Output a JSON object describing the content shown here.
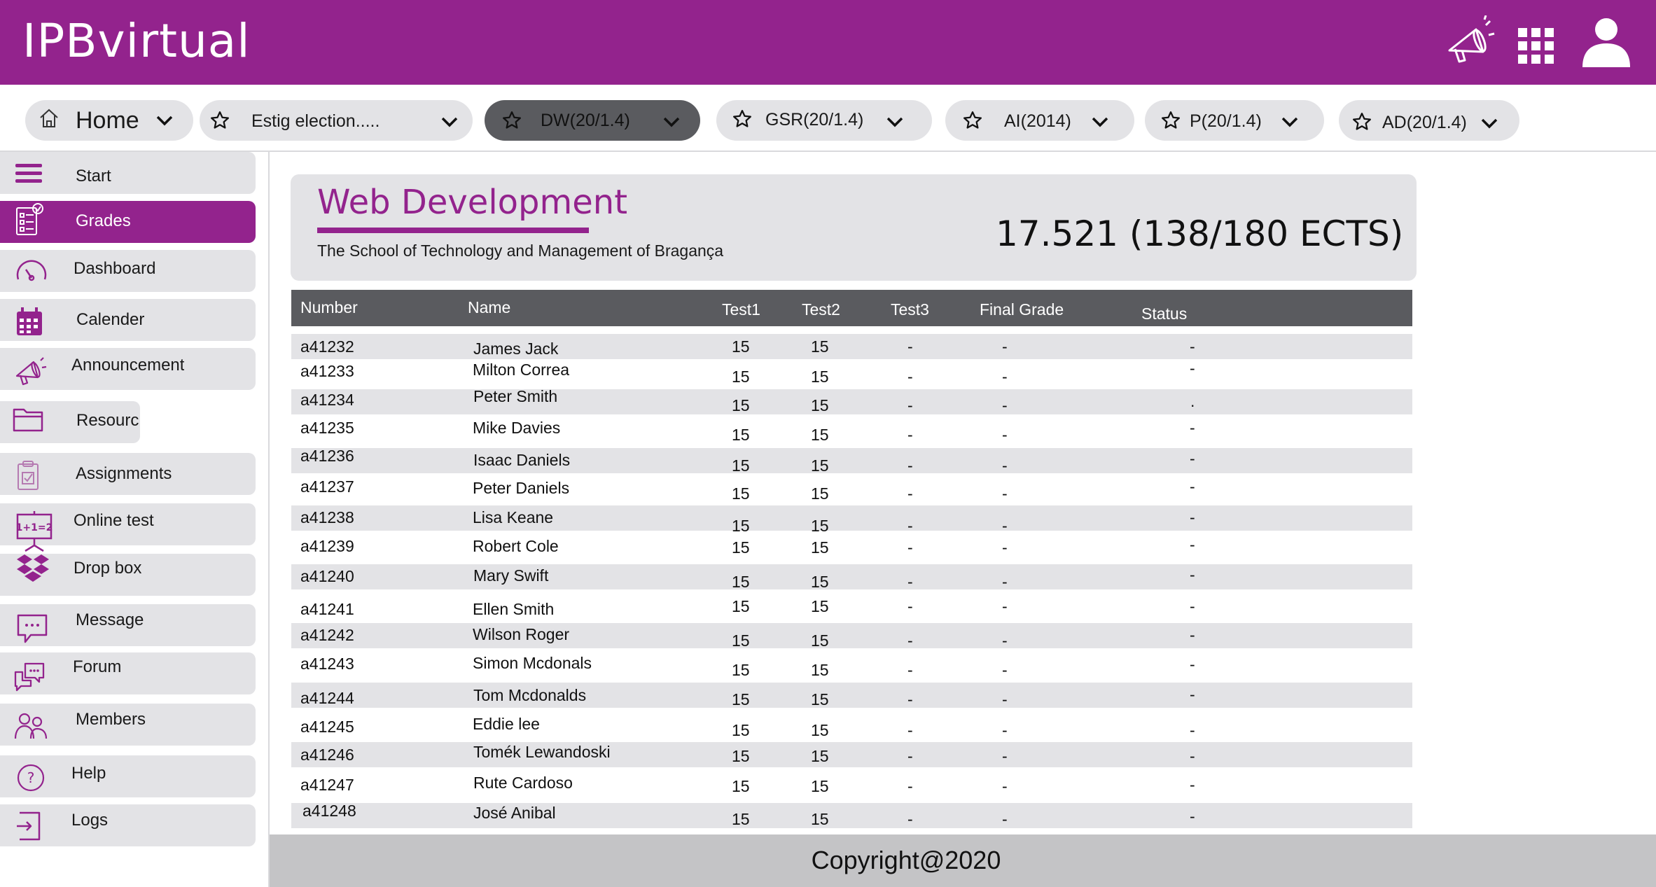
{
  "app": {
    "title": "IPBvirtual"
  },
  "header_icons": [
    "megaphone-icon",
    "apps-grid-icon",
    "user-icon"
  ],
  "colors": {
    "brand": "#93238d",
    "tab_active": "#5a5b5f",
    "surface": "#e3e3e6",
    "footer": "#c4c4c6"
  },
  "tabs": [
    {
      "label": "Home",
      "icon": "home-icon"
    },
    {
      "label": "Estig election.....",
      "icon": "star-icon"
    },
    {
      "label": "DW(20/1.4)",
      "icon": "star-icon",
      "active": true
    },
    {
      "label": "GSR(20/1.4)",
      "icon": "star-icon"
    },
    {
      "label": "AI(2014)",
      "icon": "star-icon"
    },
    {
      "label": "P(20/1.4)",
      "icon": "star-icon"
    },
    {
      "label": "AD(20/1.4)",
      "icon": "star-icon"
    }
  ],
  "sidebar": {
    "items": [
      {
        "label": "Start",
        "icon": "menu-icon"
      },
      {
        "label": "Grades",
        "icon": "grades-icon",
        "active": true
      },
      {
        "label": "Dashboard",
        "icon": "gauge-icon"
      },
      {
        "label": "Calender",
        "icon": "calendar-icon"
      },
      {
        "label": "Announcement",
        "icon": "megaphone-icon"
      },
      {
        "label": "Resourc",
        "icon": "folder-icon"
      },
      {
        "label": "Assignments",
        "icon": "clipboard-icon"
      },
      {
        "label": "Online test",
        "icon": "whiteboard-icon"
      },
      {
        "label": "Drop box",
        "icon": "dropbox-icon"
      },
      {
        "label": "Message",
        "icon": "message-icon"
      },
      {
        "label": "Forum",
        "icon": "forum-icon"
      },
      {
        "label": "Members",
        "icon": "members-icon"
      },
      {
        "label": "Help",
        "icon": "help-icon"
      },
      {
        "label": "Logs",
        "icon": "logout-icon"
      }
    ]
  },
  "course": {
    "title": "Web Development",
    "school": "The School of Technology and Management of Bragança",
    "average": "17.521 (138/180 ECTS)"
  },
  "table": {
    "headers": [
      "Number",
      "Name",
      "Test1",
      "Test2",
      "Test3",
      "Final Grade",
      "Status"
    ],
    "rows": [
      [
        "a41232",
        "James Jack",
        "15",
        "15",
        "-",
        "-",
        "-"
      ],
      [
        "a41233",
        "Milton Correa",
        "15",
        "15",
        "-",
        "-",
        "-"
      ],
      [
        "a41234",
        "Peter Smith",
        "15",
        "15",
        "-",
        "-",
        "."
      ],
      [
        "a41235",
        "Mike Davies",
        "15",
        "15",
        "-",
        "-",
        "-"
      ],
      [
        "a41236",
        "Isaac Daniels",
        "15",
        "15",
        "-",
        "-",
        "-"
      ],
      [
        "a41237",
        "Peter Daniels",
        "15",
        "15",
        "-",
        "-",
        "-"
      ],
      [
        "a41238",
        "Lisa Keane",
        "15",
        "15",
        "-",
        "-",
        "-"
      ],
      [
        "a41239",
        "Robert Cole",
        "15",
        "15",
        "-",
        "-",
        "-"
      ],
      [
        "a41240",
        "Mary Swift",
        "15",
        "15",
        "-",
        "-",
        "-"
      ],
      [
        "a41241",
        "Ellen Smith",
        "15",
        "15",
        "-",
        "-",
        "-"
      ],
      [
        "a41242",
        "Wilson Roger",
        "15",
        "15",
        "-",
        "-",
        "-"
      ],
      [
        "a41243",
        "Simon Mcdonals",
        "15",
        "15",
        "-",
        "-",
        "-"
      ],
      [
        "a41244",
        "Tom Mcdonalds",
        "15",
        "15",
        "-",
        "-",
        "-"
      ],
      [
        "a41245",
        "Eddie lee",
        "15",
        "15",
        "-",
        "-",
        "-"
      ],
      [
        "a41246",
        "Tomék Lewandoski",
        "15",
        "15",
        "-",
        "-",
        "-"
      ],
      [
        "a41247",
        "Rute Cardoso",
        "15",
        "15",
        "-",
        "-",
        "-"
      ],
      [
        "a41248",
        "José Anibal",
        "15",
        "15",
        "-",
        "-",
        "-"
      ]
    ]
  },
  "footer": {
    "text": "Copyright@2020"
  }
}
